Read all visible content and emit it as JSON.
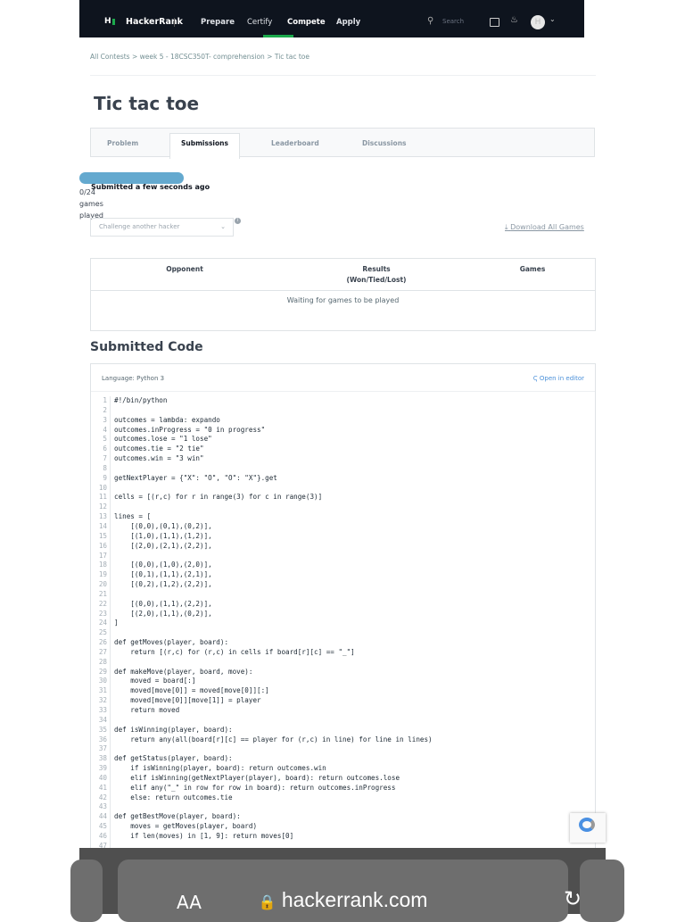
{
  "nav": {
    "logo_mark": "H",
    "brand": "HackerRank",
    "items": [
      "Prepare",
      "Certify",
      "Compete",
      "Apply"
    ],
    "active": "Compete",
    "search_placeholder": "Search",
    "avatar_initial": "H",
    "accent": "#1ba94c"
  },
  "breadcrumb": "All Contests > week 5 - 18CSC350T- comprehension > Tic tac toe",
  "title": "Tic tac toe",
  "tabs": [
    "Problem",
    "Submissions",
    "Leaderboard",
    "Discussions"
  ],
  "submission": {
    "status": "Submitted a few seconds ago",
    "progress_text": "0/24 games played",
    "progress_fraction": 0
  },
  "challenge_placeholder": "Challenge another hacker",
  "download_label": "Download All Games",
  "results_table": {
    "headers": [
      "Opponent",
      "Results\n(Won/Tied/Lost)",
      "Games"
    ],
    "empty": "Waiting for games to be played"
  },
  "code_section": {
    "heading": "Submitted Code",
    "language": "Language: Python 3",
    "open_in_editor": "Open in editor",
    "lines": [
      "#!/bin/python",
      "",
      "outcomes = lambda: expando",
      "outcomes.inProgress = \"0 in progress\"",
      "outcomes.lose = \"1 lose\"",
      "outcomes.tie = \"2 tie\"",
      "outcomes.win = \"3 win\"",
      "",
      "getNextPlayer = {\"X\": \"O\", \"O\": \"X\"}.get",
      "",
      "cells = [(r,c) for r in range(3) for c in range(3)]",
      "",
      "lines = [",
      "    [(0,0),(0,1),(0,2)],",
      "    [(1,0),(1,1),(1,2)],",
      "    [(2,0),(2,1),(2,2)],",
      "",
      "    [(0,0),(1,0),(2,0)],",
      "    [(0,1),(1,1),(2,1)],",
      "    [(0,2),(1,2),(2,2)],",
      "",
      "    [(0,0),(1,1),(2,2)],",
      "    [(2,0),(1,1),(0,2)],",
      "]",
      "",
      "def getMoves(player, board):",
      "    return [(r,c) for (r,c) in cells if board[r][c] == \"_\"]",
      "",
      "def makeMove(player, board, move):",
      "    moved = board[:]",
      "    moved[move[0]] = moved[move[0]][:]",
      "    moved[move[0]][move[1]] = player",
      "    return moved",
      "",
      "def isWinning(player, board):",
      "    return any(all(board[r][c] == player for (r,c) in line) for line in lines)",
      "",
      "def getStatus(player, board):",
      "    if isWinning(player, board): return outcomes.win",
      "    elif isWinning(getNextPlayer(player), board): return outcomes.lose",
      "    elif any(\"_\" in row for row in board): return outcomes.inProgress",
      "    else: return outcomes.tie",
      "",
      "def getBestMove(player, board):",
      "    moves = getMoves(player, board)",
      "    if len(moves) in [1, 9]: return moves[0]",
      ""
    ]
  },
  "browser": {
    "text_size_label": "AA",
    "url": "hackerrank.com"
  }
}
